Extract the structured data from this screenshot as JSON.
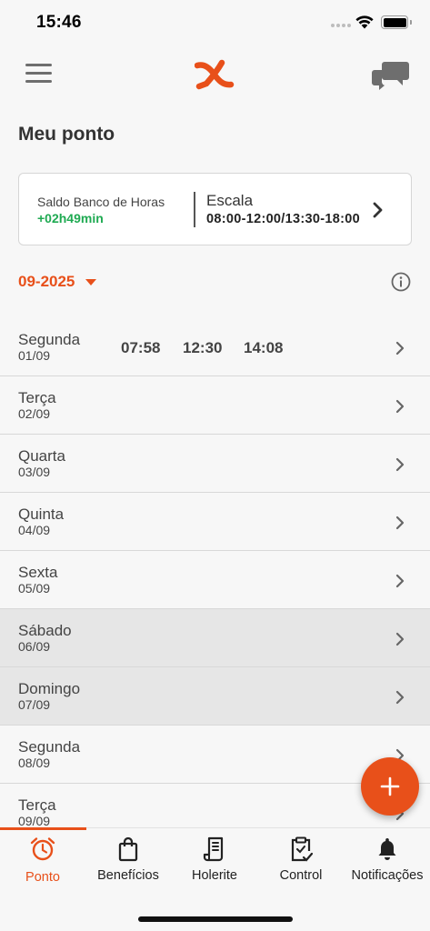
{
  "status_bar": {
    "time": "15:46"
  },
  "header": {
    "title": "Meu ponto"
  },
  "balance_card": {
    "balance_label": "Saldo Banco de Horas",
    "balance_value": "+02h49min",
    "schedule_label": "Escala",
    "schedule_value": "08:00-12:00/13:30-18:00"
  },
  "month_selector": {
    "value": "09-2025"
  },
  "days": [
    {
      "name": "Segunda",
      "date": "01/09",
      "times": [
        "07:58",
        "12:30",
        "14:08"
      ],
      "weekend": false
    },
    {
      "name": "Terça",
      "date": "02/09",
      "times": [],
      "weekend": false
    },
    {
      "name": "Quarta",
      "date": "03/09",
      "times": [],
      "weekend": false
    },
    {
      "name": "Quinta",
      "date": "04/09",
      "times": [],
      "weekend": false
    },
    {
      "name": "Sexta",
      "date": "05/09",
      "times": [],
      "weekend": false
    },
    {
      "name": "Sábado",
      "date": "06/09",
      "times": [],
      "weekend": true
    },
    {
      "name": "Domingo",
      "date": "07/09",
      "times": [],
      "weekend": true
    },
    {
      "name": "Segunda",
      "date": "08/09",
      "times": [],
      "weekend": false
    },
    {
      "name": "Terça",
      "date": "09/09",
      "times": [],
      "weekend": false
    }
  ],
  "fab": {
    "icon": "plus-icon"
  },
  "bottom_nav": {
    "items": [
      {
        "label": "Ponto",
        "icon": "alarm-clock-icon",
        "active": true
      },
      {
        "label": "Benefícios",
        "icon": "shopping-bag-icon",
        "active": false
      },
      {
        "label": "Holerite",
        "icon": "receipt-icon",
        "active": false
      },
      {
        "label": "Control",
        "icon": "clipboard-check-icon",
        "active": false
      },
      {
        "label": "Notificações",
        "icon": "bell-icon",
        "active": false
      }
    ]
  },
  "colors": {
    "accent": "#e8501a",
    "positive": "#1faa52",
    "background": "#f7f7f7",
    "weekend_row": "#e6e6e6",
    "text": "#444444"
  }
}
